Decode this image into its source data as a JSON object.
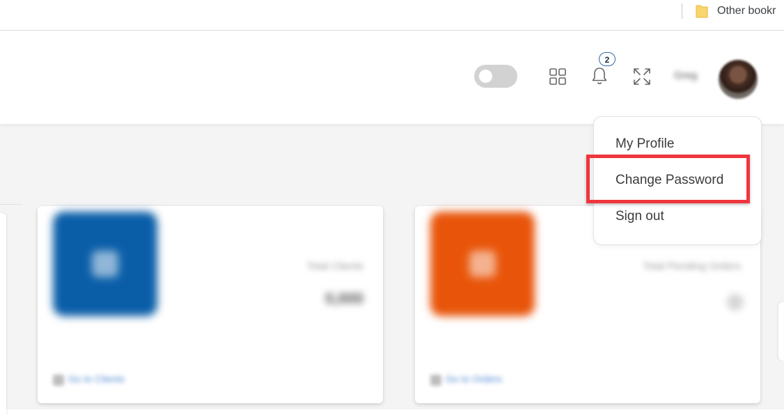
{
  "bookmarks_bar": {
    "other_bookmarks_label": "Other bookr",
    "folder_icon": "folder-icon"
  },
  "header": {
    "theme_toggle": {
      "state": "off"
    },
    "apps_icon": "apps-grid-icon",
    "notifications": {
      "icon": "bell-icon",
      "count": "2"
    },
    "fullscreen_icon": "fullscreen-icon",
    "username": "Greg",
    "avatar": "user-avatar"
  },
  "profile_menu": {
    "items": [
      {
        "label": "My Profile"
      },
      {
        "label": "Change Password"
      },
      {
        "label": "Sign out"
      }
    ],
    "highlighted": "Change Password",
    "highlight_color": "#f0353e"
  },
  "cards": [
    {
      "tile_color": "#0a5ea8",
      "caption": "Total Clients",
      "value": "0,000",
      "link": "Go to Clients"
    },
    {
      "tile_color": "#e8550a",
      "caption": "Total Pending Orders",
      "value": "0",
      "link": "Go to Orders"
    }
  ],
  "colors": {
    "badge_border": "#2d6aa8",
    "content_background": "#f4f4f4"
  }
}
